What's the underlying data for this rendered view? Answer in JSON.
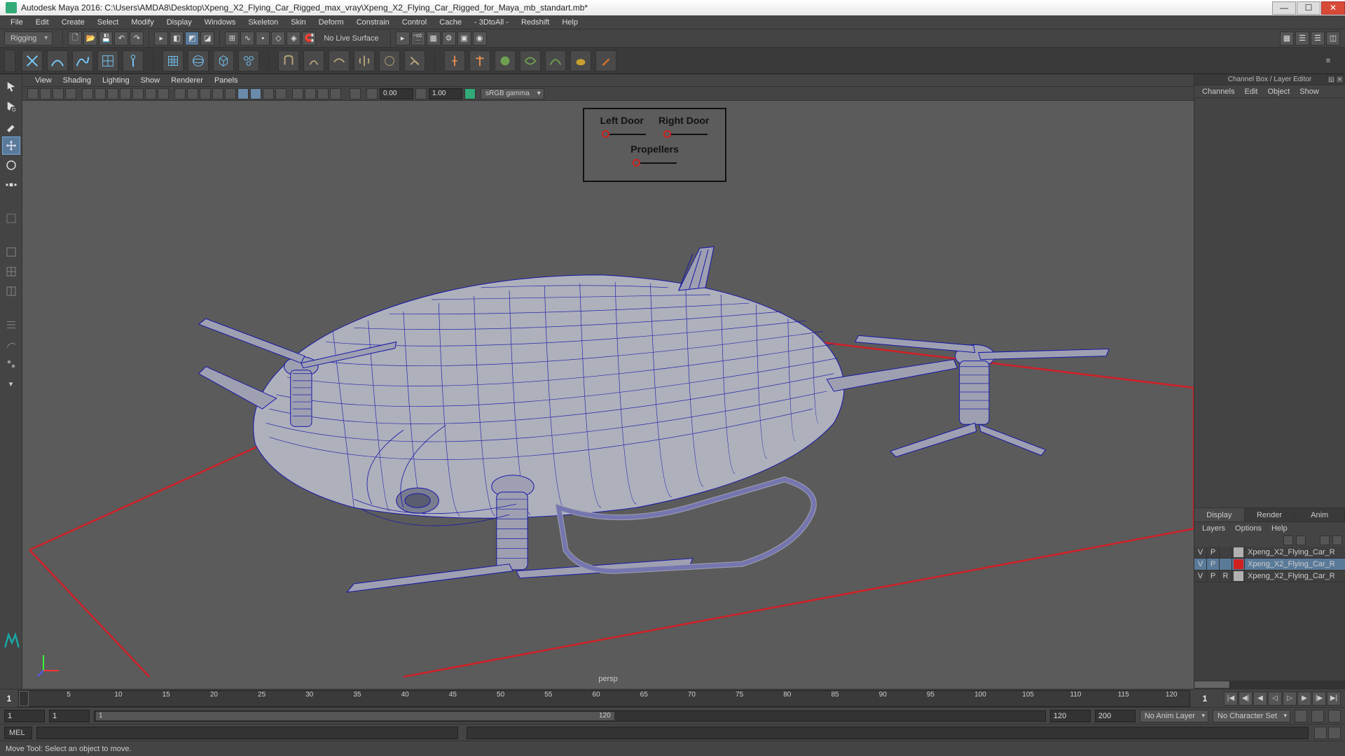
{
  "title": "Autodesk Maya 2016: C:\\Users\\AMDA8\\Desktop\\Xpeng_X2_Flying_Car_Rigged_max_vray\\Xpeng_X2_Flying_Car_Rigged_for_Maya_mb_standart.mb*",
  "menubar": [
    "File",
    "Edit",
    "Create",
    "Select",
    "Modify",
    "Display",
    "Windows",
    "Skeleton",
    "Skin",
    "Deform",
    "Constrain",
    "Control",
    "Cache",
    "- 3DtoAll -",
    "Redshift",
    "Help"
  ],
  "workspace_dropdown": "Rigging",
  "no_live": "No Live Surface",
  "panel_menu": [
    "View",
    "Shading",
    "Lighting",
    "Show",
    "Renderer",
    "Panels"
  ],
  "panel_num1": "0.00",
  "panel_num2": "1.00",
  "gamma": "sRGB gamma",
  "camera": "persp",
  "rig": {
    "left": "Left Door",
    "right": "Right Door",
    "prop": "Propellers"
  },
  "channel_box_title": "Channel Box / Layer Editor",
  "cbox_menu": [
    "Channels",
    "Edit",
    "Object",
    "Show"
  ],
  "layer_tabs": [
    "Display",
    "Render",
    "Anim"
  ],
  "layer_menu": [
    "Layers",
    "Options",
    "Help"
  ],
  "layers": [
    {
      "v": "V",
      "p": "P",
      "r": "",
      "color": "#b0b0b0",
      "name": "Xpeng_X2_Flying_Car_R",
      "sel": false
    },
    {
      "v": "V",
      "p": "P",
      "r": "",
      "color": "#d02020",
      "name": "Xpeng_X2_Flying_Car_R",
      "sel": true
    },
    {
      "v": "V",
      "p": "P",
      "r": "R",
      "color": "#b0b0b0",
      "name": "Xpeng_X2_Flying_Car_R",
      "sel": false
    }
  ],
  "timeline": {
    "start": "1",
    "end": "1",
    "ticks": [
      "5",
      "10",
      "15",
      "20",
      "25",
      "30",
      "35",
      "40",
      "45",
      "50",
      "55",
      "60",
      "65",
      "70",
      "75",
      "80",
      "85",
      "90",
      "95",
      "100",
      "105",
      "110",
      "115",
      "120"
    ]
  },
  "range": {
    "a": "1",
    "b": "1",
    "slider_left": "1",
    "slider_right": "120",
    "c": "120",
    "d": "200"
  },
  "anim_layer": "No Anim Layer",
  "char_set": "No Character Set",
  "mel": "MEL",
  "status": "Move Tool: Select an object to move."
}
